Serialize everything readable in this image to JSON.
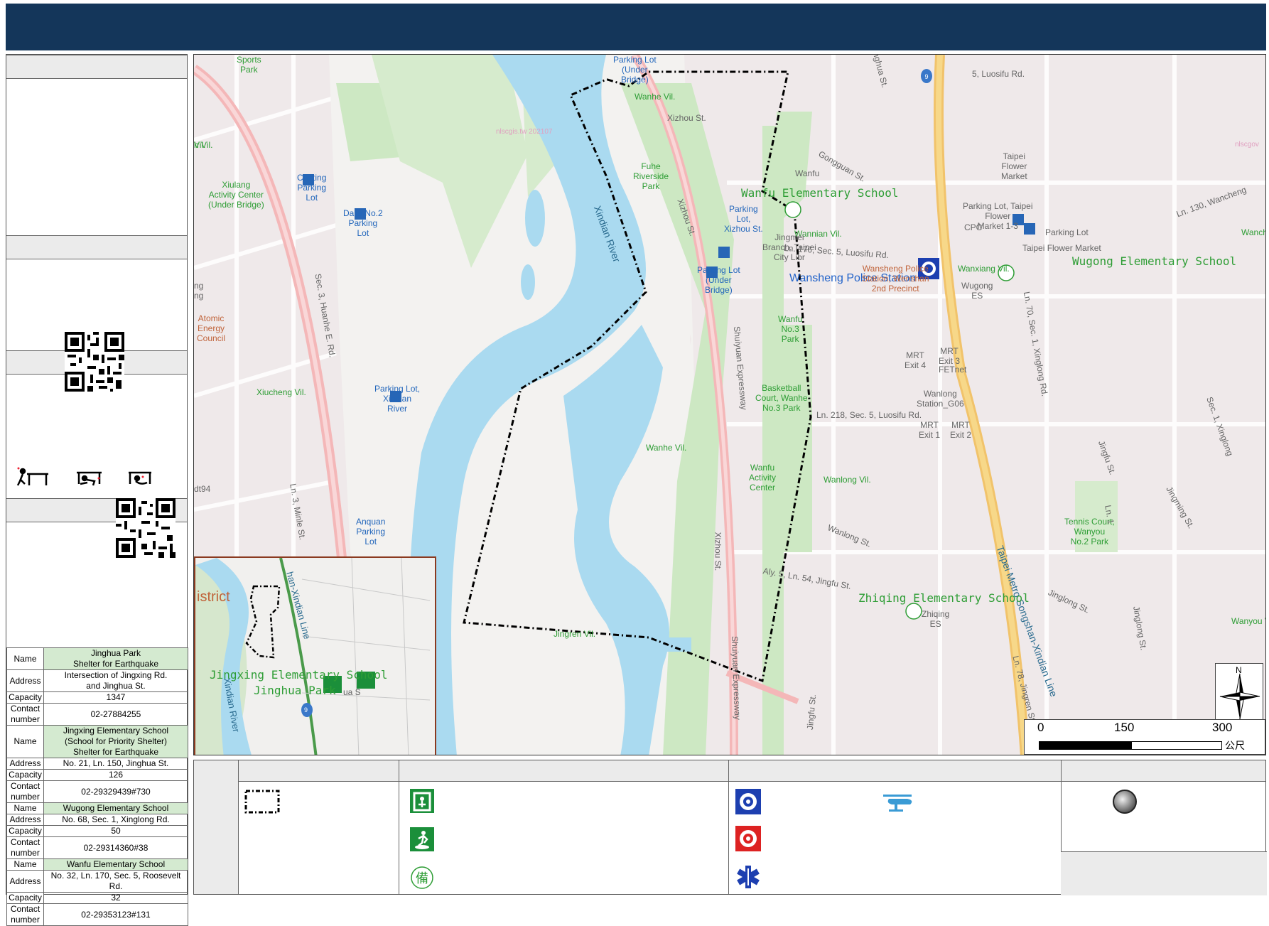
{
  "colors": {
    "header": "#14365a",
    "river": "#aadaf0",
    "park": "#cde8c3",
    "road": "#f4b7b8",
    "expressway": "#f7d889",
    "label_green": "#2e9d35"
  },
  "shelters": [
    {
      "name_label": "Name",
      "name": "Jinghua Park\nShelter for Earthquake",
      "address_label": "Address",
      "address": "Intersection of Jingxing Rd.\nand Jinghua St.",
      "capacity_label": "Capacity",
      "capacity": "1347",
      "contact_label": "Contact\nnumber",
      "contact": "02-27884255"
    },
    {
      "name_label": "Name",
      "name": "Jingxing Elementary School\n(School for Priority Shelter)\nShelter for Earthquake",
      "address_label": "Address",
      "address": "No. 21, Ln. 150, Jinghua St.",
      "capacity_label": "Capacity",
      "capacity": "126",
      "contact_label": "Contact\nnumber",
      "contact": "02-29329439#730"
    },
    {
      "name_label": "Name",
      "name": "Wugong Elementary School",
      "address_label": "Address",
      "address": "No. 68, Sec. 1, Xinglong Rd.",
      "capacity_label": "Capacity",
      "capacity": "50",
      "contact_label": "Contact\nnumber",
      "contact": "02-29314360#38"
    },
    {
      "name_label": "Name",
      "name": "Wanfu Elementary School",
      "address_label": "Address",
      "address": "No. 32, Ln. 170, Sec. 5, Roosevelt Rd.",
      "capacity_label": "Capacity",
      "capacity": "32",
      "contact_label": "Contact\nnumber",
      "contact": "02-29353123#131"
    }
  ],
  "map": {
    "labels_green": [
      "Wanhe Vil.",
      "Wannian Vil.",
      "Wanxiang Vil.",
      "Xiucheng Vil.",
      "Wanhe Vil.",
      "Wanlong Vil.",
      "Jingren Vil.",
      "Wanyou V",
      "Fuhe\nRiverside\nPark",
      "Wanfu\nActivity\nCenter",
      "Xiulang\nActivity Center\n(Under Bridge)",
      "Tennis Court,\nWanyou\nNo.2 Park",
      "Wanfu\nNo.3\nPark",
      "Basketball\nCourt, Wanhe\nNo.3 Park",
      "Sports\nPark",
      "Wanche",
      "h Vil."
    ],
    "labels_gray": [
      "Xizhou St.",
      "Gongguan St.",
      "Ln. 176, Sec. 5, Luosifu Rd.",
      "Ln. 218, Sec. 5, Luosifu Rd.",
      "Wanlong St.",
      "Aly. 5, Ln. 54, Jingfu St.",
      "Jinglong St.",
      "Ln. 130, Wancheng",
      "Sec. 3, Huanhe E. Rd.",
      "Ln. 3, Minle St.",
      "Xizhou St.",
      "Xizhou St.",
      "Shuiyuan Expressway",
      "Shuiyuan Expressway",
      "Ln. 70, Sec. 1, Xinglong Rd.",
      "Sec. 1, Xinglong",
      "Jingming St.",
      "Ln. 78, Jingren St.",
      "Jingfu St.",
      "Jinghua St.",
      "5, Luosifu Rd.",
      "Ln. 1",
      "Jinglong St.",
      "Jingfu St.",
      "Xindian River",
      "Taipei Metro Songshan-Xindian Line",
      "Cheting\nParking\nLot",
      "Da'ia No.2\nParking\nLot",
      "Parking Lot,\nXindian\nRiver",
      "Anquan\nParking\nLot",
      "Parking\nLot,\nXizhou St.",
      "Parking Lot\n(Under\nBridge)",
      "Parking Lot\n(Under\nBridge)",
      "Jingmei\nBranch, Taipei\nCity Libr",
      "Wanfu",
      "Taipei\nFlower\nMarket",
      "Parking Lot, Taipei\nFlower\nMarket 1-3",
      "Parking Lot",
      "Taipei Flower Market",
      "CPC",
      "Wugong\nES",
      "Zhiqing\nES",
      "MRT\nExit 4",
      "MRT\nExit 3",
      "FETnet",
      "Wanlong\nStation_G06",
      "MRT\nExit 1",
      "MRT\nExit 2",
      "Atomic\nEnergy\nCouncil",
      "ng\nng",
      "dt94",
      "Vil.",
      "nlscgis.tw 202107",
      "nlscgov"
    ],
    "schools": [
      "Wanfu Elementary School",
      "Wugong Elementary School",
      "Zhiqing Elementary School"
    ],
    "police": "Wansheng Police Station",
    "police_sub": "Wansheng Police\nStation, Wenshan\n2nd Precinct",
    "road_shield": "9",
    "inset": {
      "district": "istrict",
      "line": "han-Xindian Line",
      "river": "Xindian River",
      "school": "Jingxing Elementary School",
      "park": "Jinghua Park",
      "street": "ua S",
      "shield": "9"
    },
    "scale": {
      "zero": "0",
      "mid": "150",
      "max": "300",
      "unit": "公尺"
    },
    "compass": "N"
  },
  "legend": {
    "icons": [
      "boundary-dashed-box",
      "shelter-icon",
      "outdoor-shelter-icon",
      "reserve-shelter-icon",
      "police-icon",
      "fire-station-icon",
      "medical-icon",
      "helipad-icon",
      "siren-icon"
    ],
    "reserve_char": "備"
  }
}
